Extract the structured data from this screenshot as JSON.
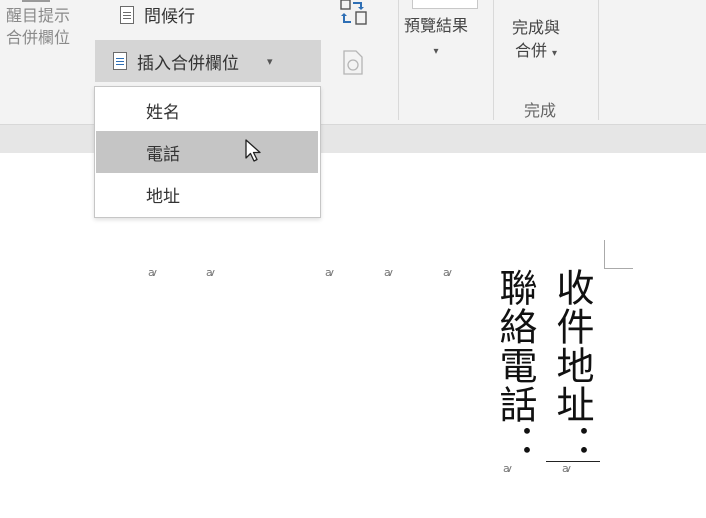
{
  "ribbon": {
    "group1": {
      "line1": "醒目提示",
      "line2": "合併欄位"
    },
    "address_block_label": "問候行",
    "insert_merge_field": {
      "label": "插入合併欄位",
      "arrow": "▾"
    },
    "preview": {
      "label": "預覽結果",
      "arrow": "▾"
    },
    "finish": {
      "line1": "完成與",
      "line2": "合併",
      "arrow": "▾",
      "group": "完成"
    }
  },
  "dropdown": {
    "items": [
      {
        "label": "姓名"
      },
      {
        "label": "電話"
      },
      {
        "label": "地址"
      }
    ]
  },
  "document": {
    "col_right": "收件地址：",
    "col_left": "聯絡電話：",
    "para_mark": "ꜹ"
  }
}
